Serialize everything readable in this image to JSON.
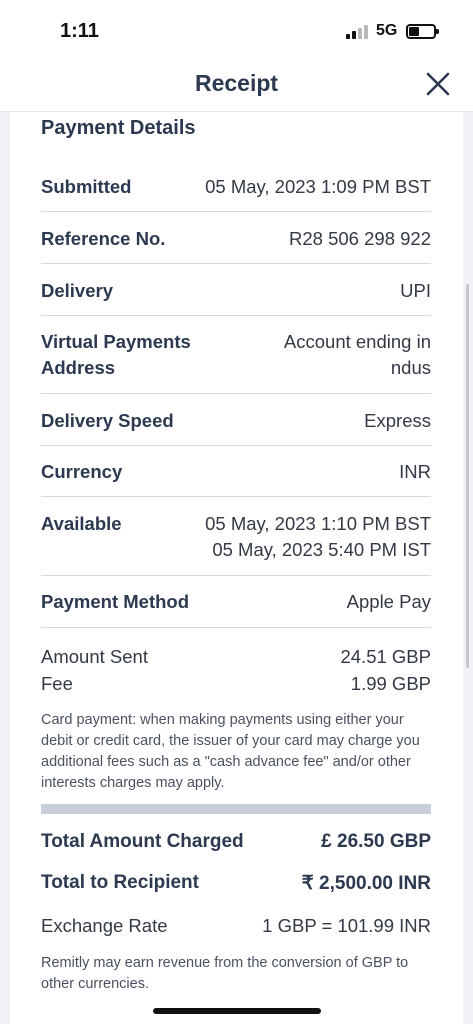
{
  "status_bar": {
    "time": "1:11",
    "network": "5G"
  },
  "header": {
    "title": "Receipt",
    "close_icon": "close-icon"
  },
  "payment_details": {
    "title": "Payment Details",
    "rows": [
      {
        "label": "Submitted",
        "value": "05 May, 2023 1:09 PM BST"
      },
      {
        "label": "Reference No.",
        "value": "R28 506 298 922"
      },
      {
        "label": "Delivery",
        "value": "UPI"
      },
      {
        "label": "Virtual Payments Address",
        "value": "Account ending in ndus"
      },
      {
        "label": "Delivery Speed",
        "value": "Express"
      },
      {
        "label": "Currency",
        "value": "INR"
      },
      {
        "label": "Available",
        "value_line1": "05 May, 2023 1:10 PM BST",
        "value_line2": "05 May, 2023 5:40 PM IST"
      },
      {
        "label": "Payment Method",
        "value": "Apple Pay"
      }
    ]
  },
  "amounts": {
    "amount_sent_label": "Amount Sent",
    "amount_sent_value": "24.51 GBP",
    "fee_label": "Fee",
    "fee_value": "1.99 GBP",
    "card_note": "Card payment: when making payments using either your debit or credit card, the issuer of your card may charge you additional fees such as a \"cash advance fee\" and/or other interests charges may apply."
  },
  "totals": {
    "total_charged_label": "Total Amount Charged",
    "total_charged_value": "£ 26.50 GBP",
    "total_recipient_label": "Total to Recipient",
    "total_recipient_value": "₹ 2,500.00 INR",
    "exchange_rate_label": "Exchange Rate",
    "exchange_rate_value": "1 GBP = 101.99 INR",
    "revenue_note": "Remitly may earn revenue from the conversion of GBP to other currencies."
  }
}
